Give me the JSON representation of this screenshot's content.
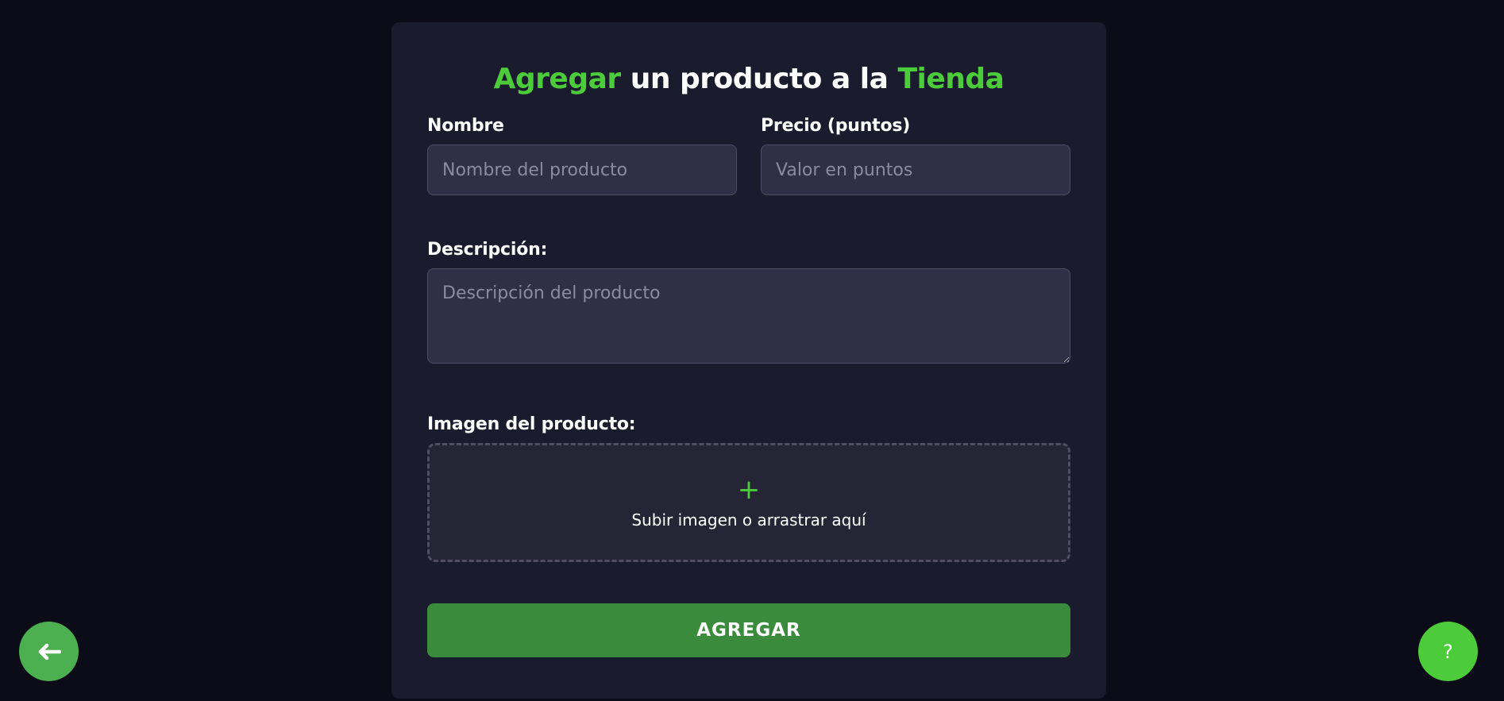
{
  "form": {
    "title_part1": "Agregar",
    "title_part2": " un producto a la ",
    "title_part3": "Tienda",
    "name_label": "Nombre",
    "name_placeholder": "Nombre del producto",
    "name_value": "",
    "price_label": "Precio (puntos)",
    "price_placeholder": "Valor en puntos",
    "price_value": "",
    "description_label": "Descripción:",
    "description_placeholder": "Descripción del producto",
    "description_value": "",
    "image_label": "Imagen del producto:",
    "upload_icon": "+",
    "upload_text": "Subir imagen o arrastrar aquí",
    "submit_label": "AGREGAR"
  },
  "floating": {
    "back_icon": "arrow-left-icon",
    "help_label": "?"
  },
  "colors": {
    "accent": "#4ccc3a",
    "background": "#0c0c18",
    "card": "#1b1b2e",
    "submit": "#3a8b3c",
    "back_button": "#4caf50"
  }
}
